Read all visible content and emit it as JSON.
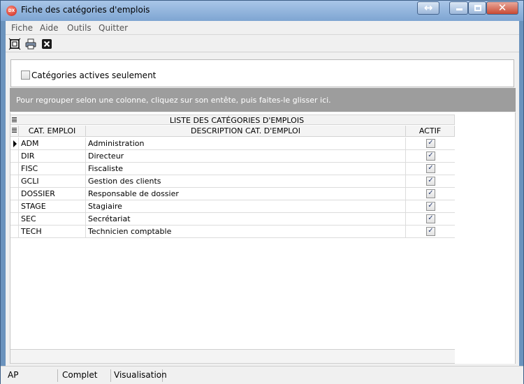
{
  "window": {
    "title": "Fiche des catégories d'emplois",
    "icon_text": "DX"
  },
  "menu": [
    "Fiche",
    "Aide",
    "Outils",
    "Quitter"
  ],
  "filter": {
    "label": "Catégories actives seulement",
    "checked": false
  },
  "group_panel": {
    "hint": "Pour regrouper selon une colonne, cliquez sur son entête, puis faites-le glisser ici."
  },
  "grid": {
    "band_title": "LISTE DES CATÉGORIES D'EMPLOIS",
    "columns": [
      "CAT. EMPLOI",
      "DESCRIPTION CAT. D'EMPLOI",
      "ACTIF"
    ],
    "rows": [
      {
        "code": "ADM",
        "description": "Administration",
        "actif": true
      },
      {
        "code": "DIR",
        "description": "Directeur",
        "actif": true
      },
      {
        "code": "FISC",
        "description": "Fiscaliste",
        "actif": true
      },
      {
        "code": "GCLI",
        "description": "Gestion des clients",
        "actif": true
      },
      {
        "code": "DOSSIER",
        "description": "Responsable de dossier",
        "actif": true
      },
      {
        "code": "STAGE",
        "description": "Stagiaire",
        "actif": true
      },
      {
        "code": "SEC",
        "description": "Secrétariat",
        "actif": true
      },
      {
        "code": "TECH",
        "description": "Technicien comptable",
        "actif": true
      }
    ]
  },
  "navigator": {
    "buttons": [
      {
        "name": "first-page-button",
        "glyph": "⏮",
        "enabled": false
      },
      {
        "name": "prev-page-button",
        "glyph": "⏪",
        "enabled": false
      },
      {
        "name": "prev-record-button",
        "glyph": "◂",
        "enabled": false
      },
      {
        "name": "next-record-button",
        "glyph": "▸",
        "enabled": true
      },
      {
        "name": "next-page-button",
        "glyph": "⏩",
        "enabled": true
      },
      {
        "name": "last-record-button",
        "glyph": "⏭",
        "enabled": true
      },
      {
        "name": "add-record-button",
        "glyph": "+",
        "enabled": true
      },
      {
        "name": "delete-record-button",
        "glyph": "−",
        "enabled": true
      },
      {
        "name": "edit-record-button",
        "glyph": "▴",
        "enabled": true
      },
      {
        "name": "post-edit-button",
        "glyph": "✓",
        "enabled": false
      },
      {
        "name": "cancel-edit-button",
        "glyph": "✕",
        "enabled": false
      },
      {
        "name": "refresh-button",
        "glyph": "↻",
        "enabled": true
      },
      {
        "name": "save-bookmark-button",
        "glyph": "✱",
        "enabled": true
      },
      {
        "name": "goto-bookmark-button",
        "glyph": "✳",
        "enabled": false
      },
      {
        "name": "filter-button",
        "glyph": "▼",
        "enabled": true
      },
      {
        "name": "print-grid-button",
        "glyph": "⎙",
        "enabled": true
      }
    ]
  },
  "status": [
    "AP",
    "Complet",
    "Visualisation"
  ],
  "colors": {
    "accent_red": "#c8241a",
    "group_panel": "#9d9d9d",
    "title_gradient": "#7ea5d2"
  }
}
